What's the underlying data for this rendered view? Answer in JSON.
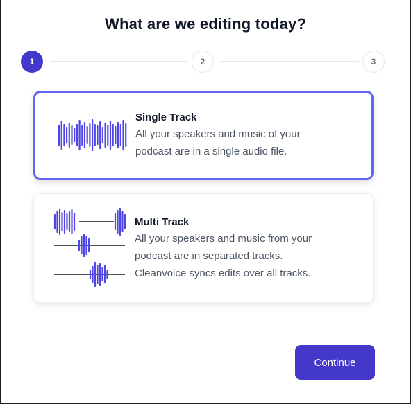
{
  "title": "What are we editing today?",
  "stepper": {
    "steps": [
      "1",
      "2",
      "3"
    ],
    "active_step": 1
  },
  "options": [
    {
      "title": "Single Track",
      "lines": [
        "All your speakers and music of your",
        "podcast are in a single audio file."
      ],
      "selected": true
    },
    {
      "title": "Multi Track",
      "lines": [
        "All your speakers and music from your",
        "podcast are in separated tracks.",
        "Cleanvoice syncs edits over all tracks."
      ],
      "selected": false
    }
  ],
  "continue_label": "Continue",
  "colors": {
    "primary": "#4338ca",
    "selected_border": "#6366f1",
    "waveform": "#4f46e5",
    "line": "#111827"
  }
}
